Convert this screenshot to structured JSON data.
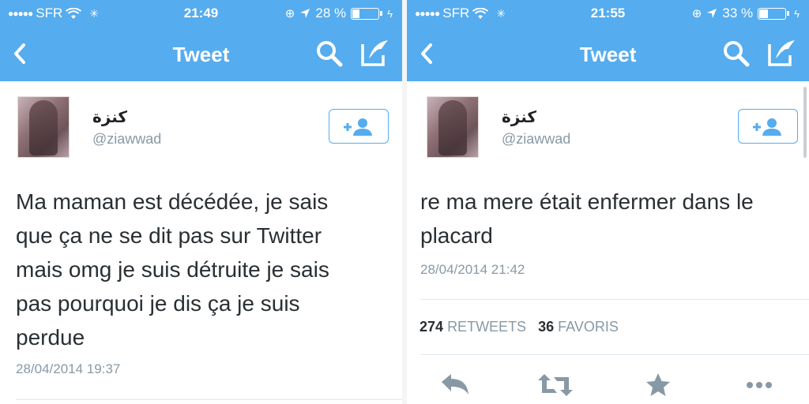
{
  "screens": [
    {
      "status": {
        "signal": "●●●●●",
        "carrier": "SFR",
        "time": "21:49",
        "battery": "28 %",
        "battery_level": 0.28
      },
      "nav": {
        "title": "Tweet"
      },
      "profile": {
        "name": "كنزة",
        "handle": "@ziawwad"
      },
      "tweet": {
        "lines": [
          "Ma maman est décédée, je sais",
          "que ça ne se dit pas sur Twitter",
          "mais omg je suis détruite je sais",
          "pas pourquoi je dis ça je suis",
          "perdue"
        ],
        "timestamp": "28/04/2014 19:37"
      }
    },
    {
      "status": {
        "signal": "●●●●●",
        "carrier": "SFR",
        "time": "21:55",
        "battery": "33 %",
        "battery_level": 0.33
      },
      "nav": {
        "title": "Tweet"
      },
      "profile": {
        "name": "كنزة",
        "handle": "@ziawwad"
      },
      "tweet": {
        "lines": [
          "re ma mere était enfermer dans le",
          "placard"
        ],
        "timestamp": "28/04/2014 21:42"
      },
      "stats": {
        "retweets_count": "274",
        "retweets_label": "RETWEETS",
        "favorites_count": "36",
        "favorites_label": "FAVORIS"
      }
    }
  ],
  "colors": {
    "brand": "#55acee",
    "text": "#292f33",
    "muted": "#8899a6",
    "action_icon": "#8899a6"
  },
  "icons": [
    "back-chevron-icon",
    "search-icon",
    "compose-icon",
    "follow-user-icon",
    "wifi-icon",
    "location-icon",
    "reply-icon",
    "retweet-icon",
    "favorite-star-icon",
    "more-icon"
  ]
}
